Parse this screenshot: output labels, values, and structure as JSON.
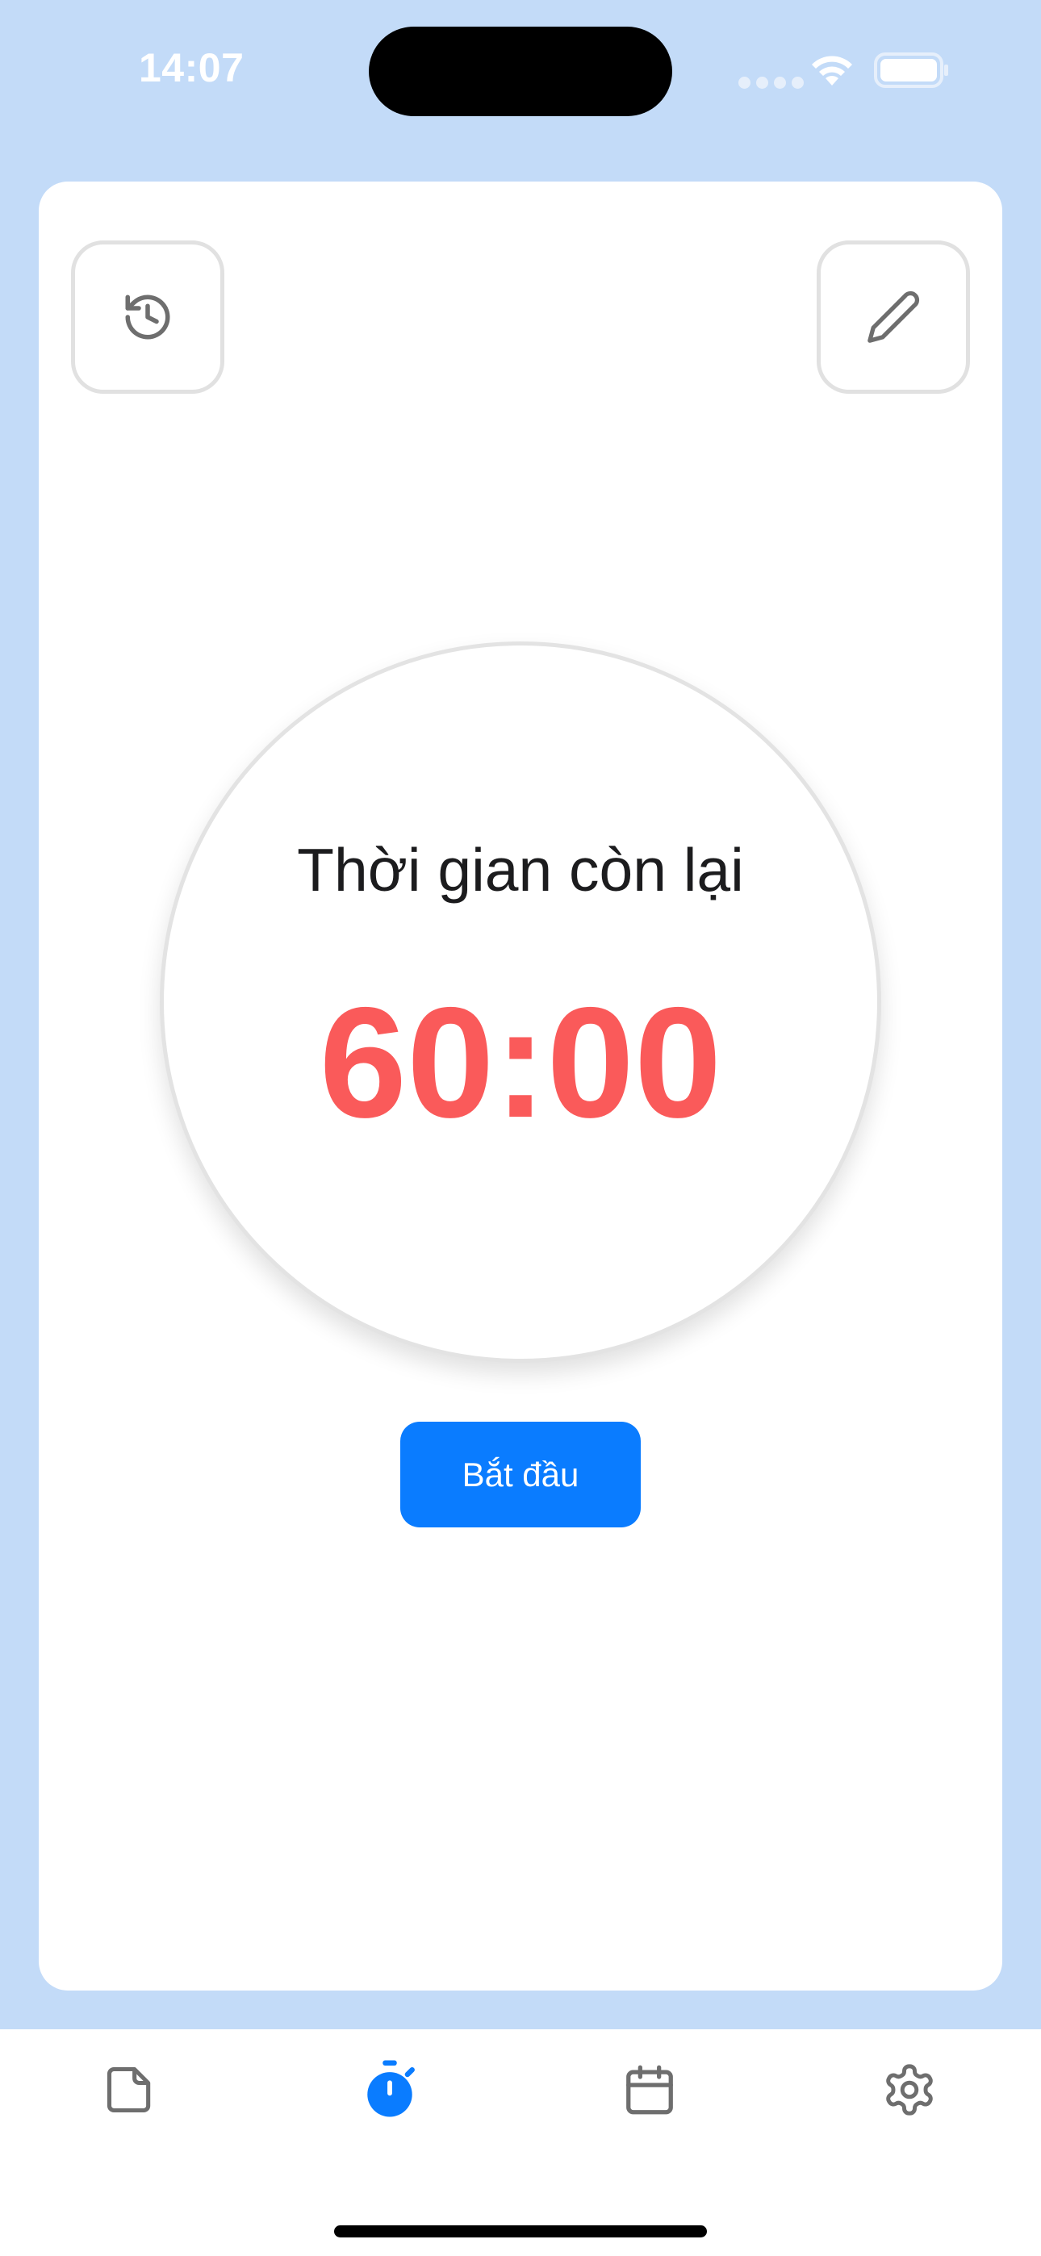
{
  "status_bar": {
    "time": "14:07"
  },
  "timer": {
    "label": "Thời gian còn lại",
    "value": "60:00"
  },
  "actions": {
    "start_label": "Bắt đầu",
    "history_icon": "history-icon",
    "edit_icon": "pencil-icon"
  },
  "tab_bar": {
    "items": [
      {
        "icon": "note-icon",
        "active": false
      },
      {
        "icon": "stopwatch-icon",
        "active": true
      },
      {
        "icon": "calendar-icon",
        "active": false
      },
      {
        "icon": "gear-icon",
        "active": false
      }
    ]
  },
  "colors": {
    "background": "#c3dbf8",
    "accent": "#0a7cff",
    "timer_text": "#fa5a5a",
    "icon_inactive": "#6e6e6e"
  }
}
